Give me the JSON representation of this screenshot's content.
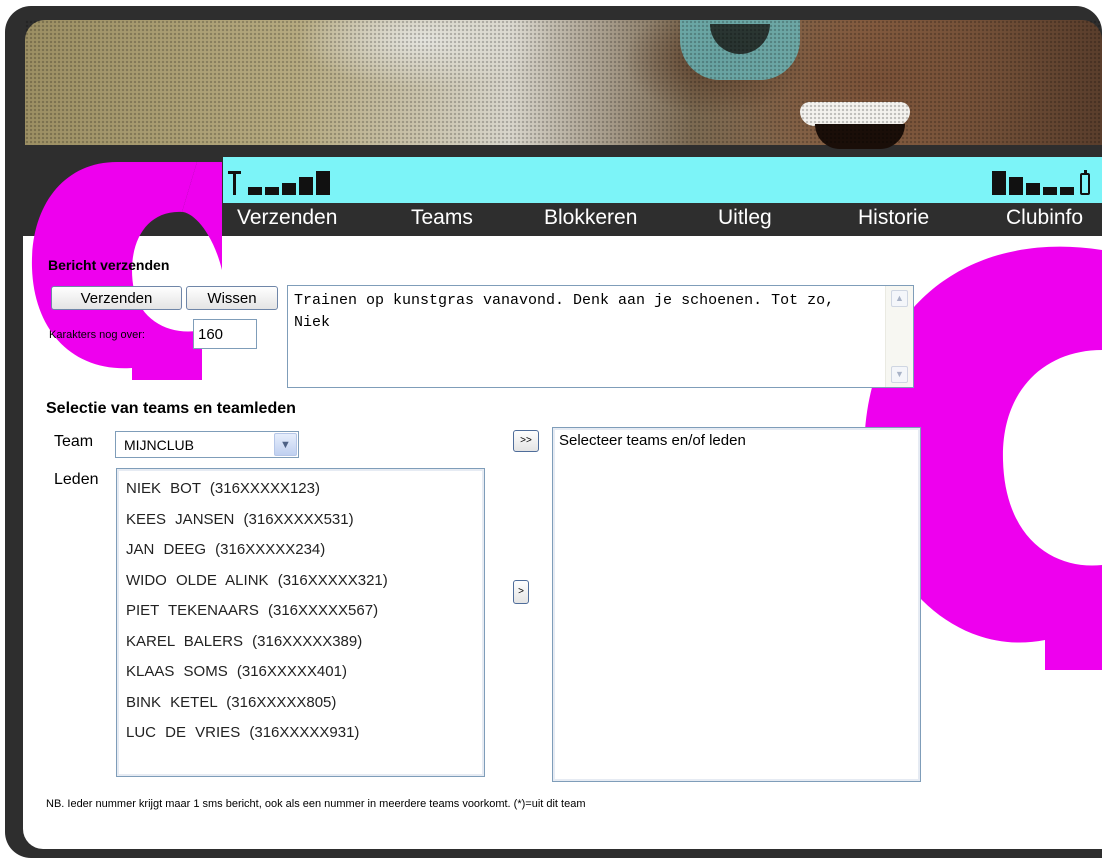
{
  "colors": {
    "brand_magenta": "#ee00ee",
    "statusbar_cyan": "#7cf4f8",
    "frame_dark": "#2e2e2e"
  },
  "statusbar": {
    "signal_icon": "signal-strength-icon",
    "battery_icon": "battery-level-icon"
  },
  "nav": {
    "items": [
      {
        "label": "Verzenden"
      },
      {
        "label": "Teams"
      },
      {
        "label": "Blokkeren"
      },
      {
        "label": "Uitleg"
      },
      {
        "label": "Historie"
      },
      {
        "label": "Clubinfo"
      }
    ]
  },
  "compose": {
    "title": "Bericht verzenden",
    "send_label": "Verzenden",
    "clear_label": "Wissen",
    "chars_left_label": "Karakters nog over:",
    "chars_left_value": "160",
    "message": "Trainen op kunstgras vanavond. Denk aan je schoenen. Tot zo, Niek"
  },
  "selection": {
    "title": "Selectie van teams en teamleden",
    "team_label": "Team",
    "team_value": "MIJNCLUB",
    "members_label": "Leden",
    "members": [
      "NIEK BOT (316XXXXX123)",
      "KEES JANSEN (316XXXXX531)",
      "JAN DEEG (316XXXXX234)",
      "WIDO OLDE ALINK (316XXXXX321)",
      "PIET TEKENAARS (316XXXXX567)",
      "KAREL BALERS (316XXXXX389)",
      "KLAAS SOMS (316XXXXX401)",
      "BINK KETEL (316XXXXX805)",
      "LUC DE VRIES (316XXXXX931)"
    ],
    "add_team_label": ">>",
    "add_member_label": ">",
    "selected_placeholder": "Selecteer teams en/of leden"
  },
  "footnote": "NB. Ieder nummer krijgt maar 1 sms bericht, ook als een nummer in meerdere teams voorkomt.    (*)=uit dit team"
}
